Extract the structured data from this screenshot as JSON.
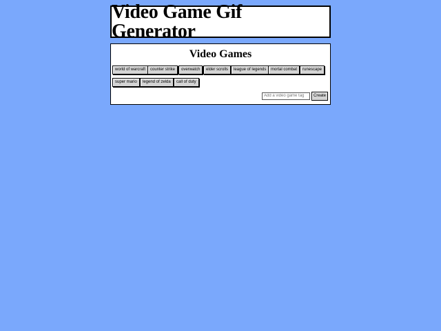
{
  "header": {
    "title": "Video Game Gif Generator"
  },
  "games_panel": {
    "title": "Video Games",
    "tags": [
      "world of warcraft",
      "counter strike",
      "overwatch",
      "elder scrolls",
      "league of legends",
      "mortal combat",
      "runescape",
      "super mario",
      "legend of zelda",
      "call of duty"
    ],
    "input_value": "",
    "input_placeholder": "Add a video game tag",
    "create_label": "Create"
  },
  "colors": {
    "page_background": "#7aa8fc",
    "panel_background": "#ffffff",
    "button_face": "#d4d4d4"
  }
}
